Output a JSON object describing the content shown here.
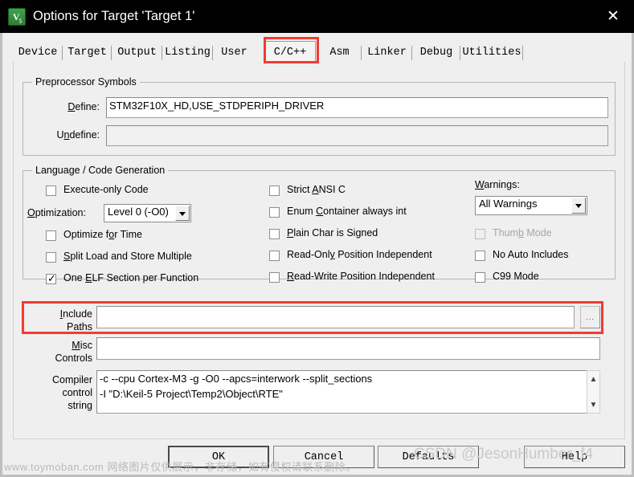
{
  "window": {
    "title": "Options for Target 'Target 1'",
    "icon": "uvision-icon",
    "close_label": "✕"
  },
  "tabs": [
    {
      "label": "Device",
      "selected": false
    },
    {
      "label": "Target",
      "selected": false
    },
    {
      "label": "Output",
      "selected": false
    },
    {
      "label": "Listing",
      "selected": false
    },
    {
      "label": "User",
      "selected": false
    },
    {
      "label": "C/C++",
      "selected": true
    },
    {
      "label": "Asm",
      "selected": false
    },
    {
      "label": "Linker",
      "selected": false
    },
    {
      "label": "Debug",
      "selected": false
    },
    {
      "label": "Utilities",
      "selected": false
    }
  ],
  "preprocessor": {
    "group_title": "Preprocessor Symbols",
    "define_label": "Define:",
    "define_value": "STM32F10X_HD,USE_STDPERIPH_DRIVER",
    "undefine_label": "Undefine:",
    "undefine_value": ""
  },
  "language": {
    "group_title": "Language / Code Generation",
    "col1": [
      {
        "label": "Execute-only Code",
        "checked": false,
        "enabled": true
      },
      {
        "label": "Optimize for Time",
        "checked": false,
        "enabled": true
      },
      {
        "label": "Split Load and Store Multiple",
        "checked": false,
        "enabled": true
      },
      {
        "label": "One ELF Section per Function",
        "checked": true,
        "enabled": true
      }
    ],
    "optimization_label": "Optimization:",
    "optimization_value": "Level 0 (-O0)",
    "col2": [
      {
        "label": "Strict ANSI C",
        "checked": false,
        "enabled": true
      },
      {
        "label": "Enum Container always int",
        "checked": false,
        "enabled": true
      },
      {
        "label": "Plain Char is Signed",
        "checked": false,
        "enabled": true
      },
      {
        "label": "Read-Only Position Independent",
        "checked": false,
        "enabled": true
      },
      {
        "label": "Read-Write Position Independent",
        "checked": false,
        "enabled": true
      }
    ],
    "warnings_label": "Warnings:",
    "warnings_value": "All Warnings",
    "col3": [
      {
        "label": "Thumb Mode",
        "checked": false,
        "enabled": false
      },
      {
        "label": "No Auto Includes",
        "checked": false,
        "enabled": true
      },
      {
        "label": "C99 Mode",
        "checked": false,
        "enabled": true
      }
    ]
  },
  "paths": {
    "include_label_line1": "Include",
    "include_label_line2": "Paths",
    "include_value": "",
    "browse_label": "...",
    "misc_label_line1": "Misc",
    "misc_label_line2": "Controls",
    "misc_value": "",
    "compiler_label_line1": "Compiler",
    "compiler_label_line2": "control",
    "compiler_label_line3": "string",
    "compiler_value": "-c --cpu Cortex-M3 -g -O0 --apcs=interwork --split_sections\n-I \"D:\\Keil-5 Project\\Temp2\\Object\\RTE\"",
    "scroll_up": "▲",
    "scroll_down": "▼"
  },
  "buttons": {
    "ok": "OK",
    "cancel": "Cancel",
    "defaults": "Defaults",
    "help": "Help"
  },
  "watermarks": {
    "bottom": "www.toymoban.com 网络图片仅供展示，非存储，如有侵权请联系删除。",
    "csdn": "CSDN @JesonHumber_f4"
  },
  "colors": {
    "highlight": "#f23b32",
    "dialog_bg": "#efefef",
    "titlebar_bg": "#000000"
  }
}
